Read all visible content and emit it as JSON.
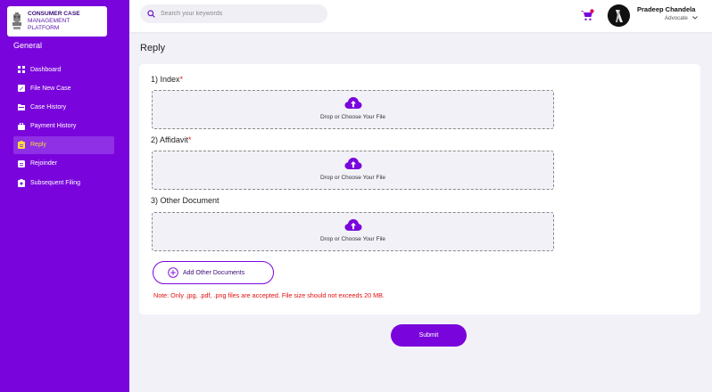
{
  "brand": {
    "line1": "CONSUMER CASE",
    "line2": "MANAGEMENT",
    "line3": "PLATFORM",
    "emblem_icon": "national-emblem-icon"
  },
  "sidebar": {
    "section": "General",
    "items": [
      {
        "label": "Dashboard",
        "icon": "grid-icon",
        "active": false
      },
      {
        "label": "File New Case",
        "icon": "edit-icon",
        "active": false
      },
      {
        "label": "Case History",
        "icon": "folder-icon",
        "active": false
      },
      {
        "label": "Payment History",
        "icon": "briefcase-icon",
        "active": false
      },
      {
        "label": "Reply",
        "icon": "clipboard-icon",
        "active": true
      },
      {
        "label": "Rejoinder",
        "icon": "document-icon",
        "active": false
      },
      {
        "label": "Subsequent Filing",
        "icon": "file-list-icon",
        "active": false
      }
    ]
  },
  "topbar": {
    "search_placeholder": "Search your keywords",
    "user_name": "Pradeep Chandela",
    "user_role": "Advocate"
  },
  "main": {
    "title": "Reply",
    "documents": [
      {
        "label": "1) Index",
        "required": "*",
        "drop_text": "Drop or Choose Your File"
      },
      {
        "label": "2) Affidavit",
        "required": "*",
        "drop_text": "Drop or Choose Your File"
      },
      {
        "label": "3) Other Document",
        "required": "",
        "drop_text": "Drop or Choose Your File"
      }
    ],
    "add_button": "Add Other Documents",
    "note": "Note: Only .jpg, .pdf, .png files are accepted. File size should not exceeds 20 MB.",
    "submit": "Submit"
  },
  "colors": {
    "brand": "#7a05dc",
    "active_text": "#f6dd3b",
    "error": "#e01010",
    "background": "#f3f1f8"
  }
}
